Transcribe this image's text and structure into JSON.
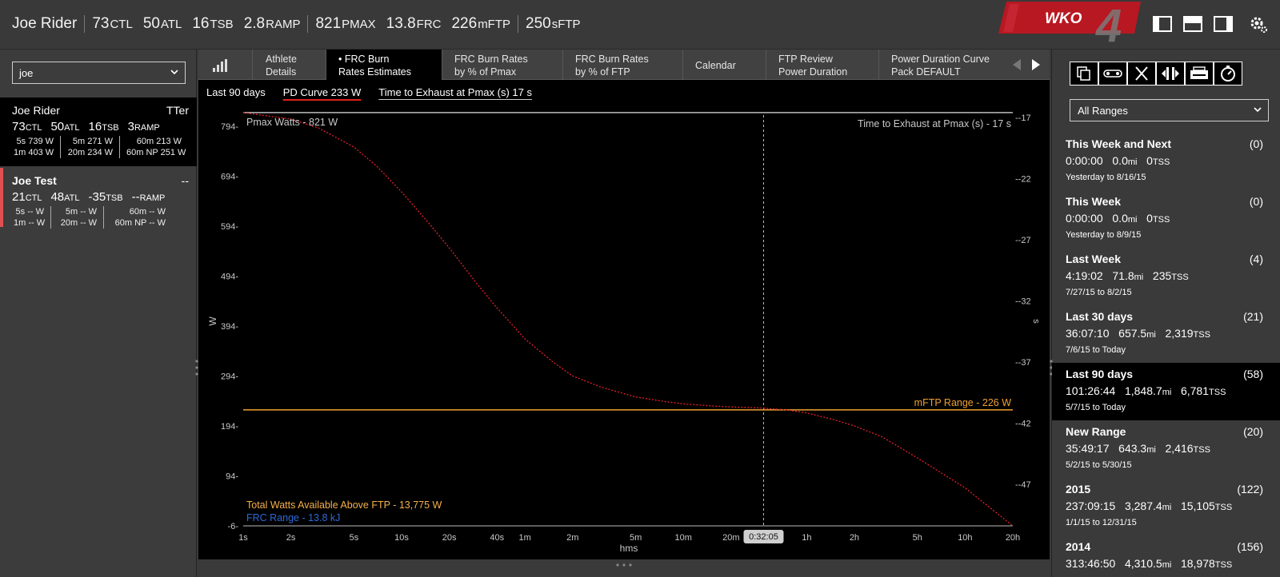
{
  "header": {
    "athlete": "Joe Rider",
    "metrics": [
      {
        "value": "73",
        "unit": "CTL"
      },
      {
        "value": "50",
        "unit": "ATL"
      },
      {
        "value": "16",
        "unit": "TSB"
      },
      {
        "value": "2.8",
        "unit": "RAMP"
      },
      {
        "value": "821",
        "unit": "PMAX"
      },
      {
        "value": "13.8",
        "unit": "FRC"
      },
      {
        "value": "226",
        "unit": "mFTP"
      },
      {
        "value": "250",
        "unit": "sFTP"
      }
    ],
    "logo_text": "WKO",
    "logo_number": "4",
    "icons": [
      "left-panel-icon",
      "top-panel-icon",
      "right-panel-icon",
      "gear-icon"
    ]
  },
  "left_panel": {
    "athlete_select": "joe",
    "athletes": [
      {
        "name": "Joe Rider",
        "tag": "TTer",
        "stats": [
          {
            "v": "73",
            "u": "CTL"
          },
          {
            "v": "50",
            "u": "ATL"
          },
          {
            "v": "16",
            "u": "TSB"
          },
          {
            "v": "3",
            "u": "RAMP"
          }
        ],
        "power": [
          [
            "5s 739 W",
            "1m 403 W"
          ],
          [
            "5m 271 W",
            "20m 234 W"
          ],
          [
            "60m 213 W",
            "60m NP 251 W"
          ]
        ]
      },
      {
        "name": "Joe Test",
        "tag": "--",
        "stats": [
          {
            "v": "21",
            "u": "CTL"
          },
          {
            "v": "48",
            "u": "ATL"
          },
          {
            "v": "-35",
            "u": "TSB"
          },
          {
            "v": "--",
            "u": "RAMP"
          }
        ],
        "power": [
          [
            "5s -- W",
            "1m -- W"
          ],
          [
            "5m -- W",
            "20m -- W"
          ],
          [
            "60m -- W",
            "60m NP -- W"
          ]
        ]
      }
    ]
  },
  "tabs": [
    {
      "line1": "Athlete",
      "line2": "Details"
    },
    {
      "line1": "• FRC Burn",
      "line2": "Rates Estimates"
    },
    {
      "line1": "FRC Burn Rates",
      "line2": "by % of Pmax"
    },
    {
      "line1": "FRC Burn Rates",
      "line2": "by % of FTP"
    },
    {
      "line1": "Calendar",
      "line2": ""
    },
    {
      "line1": "FTP Review",
      "line2": "Power Duration"
    },
    {
      "line1": "Power Duration Curve",
      "line2": "Pack DEFAULT"
    }
  ],
  "subtabs": {
    "range": "Last 90 days",
    "pd_curve": "PD Curve  233 W",
    "time_to_exhaust": "Time to Exhaust at Pmax (s)  17 s"
  },
  "chart_data": {
    "type": "line",
    "xlabel": "hms",
    "ylabel": "W",
    "y2label": "s",
    "x_ticks": [
      "1s",
      "2s",
      "5s",
      "10s",
      "20s",
      "40s",
      "1m",
      "2m",
      "5m",
      "10m",
      "20m",
      "1h",
      "2h",
      "5h",
      "10h",
      "20h"
    ],
    "x_ticks_seconds": [
      1,
      2,
      5,
      10,
      20,
      40,
      60,
      120,
      300,
      600,
      1200,
      3600,
      7200,
      18000,
      36000,
      72000
    ],
    "x_scale": "log",
    "xlim_seconds": [
      1,
      72000
    ],
    "y_ticks": [
      -6,
      94,
      194,
      294,
      394,
      494,
      594,
      694,
      794
    ],
    "ylim": [
      -6,
      816
    ],
    "y2_ticks": [
      -17,
      -22,
      -27,
      -32,
      -37,
      -42,
      -47
    ],
    "y2lim": [
      -50.4,
      -16.8
    ],
    "cursor_label": "0:32:05",
    "cursor_seconds": 1925,
    "annotations": {
      "pmax": "Pmax Watts - 821 W",
      "tte": "Time to Exhaust at Pmax (s) - 17 s",
      "mftp": "mFTP Range - 226 W",
      "total": "Total Watts Available Above FTP - 13,775 W",
      "frc": "FRC Range - 13.8 kJ"
    },
    "pmax_value": 821,
    "mftp_value": 226,
    "series": [
      {
        "name": "PD Curve",
        "x_seconds": [
          1,
          2,
          3,
          5,
          7,
          10,
          15,
          20,
          30,
          40,
          60,
          90,
          120,
          180,
          300,
          450,
          600,
          900,
          1200,
          1800,
          2700,
          3600,
          5400,
          7200,
          10800,
          18000,
          36000,
          72000
        ],
        "y": [
          821,
          808,
          790,
          752,
          713,
          662,
          598,
          550,
          478,
          430,
          368,
          322,
          294,
          272,
          252,
          243,
          238,
          234,
          232,
          230,
          226,
          220,
          206,
          194,
          172,
          130,
          70,
          -6
        ]
      }
    ]
  },
  "right_panel": {
    "toolbar_icons": [
      "copy-icon",
      "bike-icon",
      "cross-icon",
      "expand-icon",
      "printer-icon",
      "stopwatch-icon"
    ],
    "range_select": "All Ranges",
    "ranges": [
      {
        "title": "This Week and Next",
        "count": "(0)",
        "time": "0:00:00",
        "dist": "0.0",
        "tss": "0",
        "dates": "Yesterday  to  8/16/15"
      },
      {
        "title": "This Week",
        "count": "(0)",
        "time": "0:00:00",
        "dist": "0.0",
        "tss": "0",
        "dates": "Yesterday  to  8/9/15"
      },
      {
        "title": "Last Week",
        "count": "(4)",
        "time": "4:19:02",
        "dist": "71.8",
        "tss": "235",
        "dates": "7/27/15  to  8/2/15"
      },
      {
        "title": "Last 30 days",
        "count": "(21)",
        "time": "36:07:10",
        "dist": "657.5",
        "tss": "2,319",
        "dates": "7/6/15  to  Today"
      },
      {
        "title": "Last 90 days",
        "count": "(58)",
        "time": "101:26:44",
        "dist": "1,848.7",
        "tss": "6,781",
        "dates": "5/7/15  to  Today"
      },
      {
        "title": "New Range",
        "count": "(20)",
        "time": "35:49:17",
        "dist": "643.3",
        "tss": "2,416",
        "dates": "5/2/15  to  5/30/15"
      },
      {
        "title": "2015",
        "count": "(122)",
        "time": "237:09:15",
        "dist": "3,287.4",
        "tss": "15,105",
        "dates": "1/1/15  to  12/31/15"
      },
      {
        "title": "2014",
        "count": "(156)",
        "time": "313:46:50",
        "dist": "4,310.5",
        "tss": "18,978",
        "dates": ""
      }
    ],
    "dist_unit": "mi",
    "tss_unit": "TSS"
  },
  "colors": {
    "curve": "#e0202a",
    "mftp": "#f0a030",
    "total_label": "#f5b04a",
    "frc_label": "#2e6ad8",
    "active_tab_underline": "#e02020",
    "accent_red": "#c01818",
    "status_strip": "#e05050"
  }
}
